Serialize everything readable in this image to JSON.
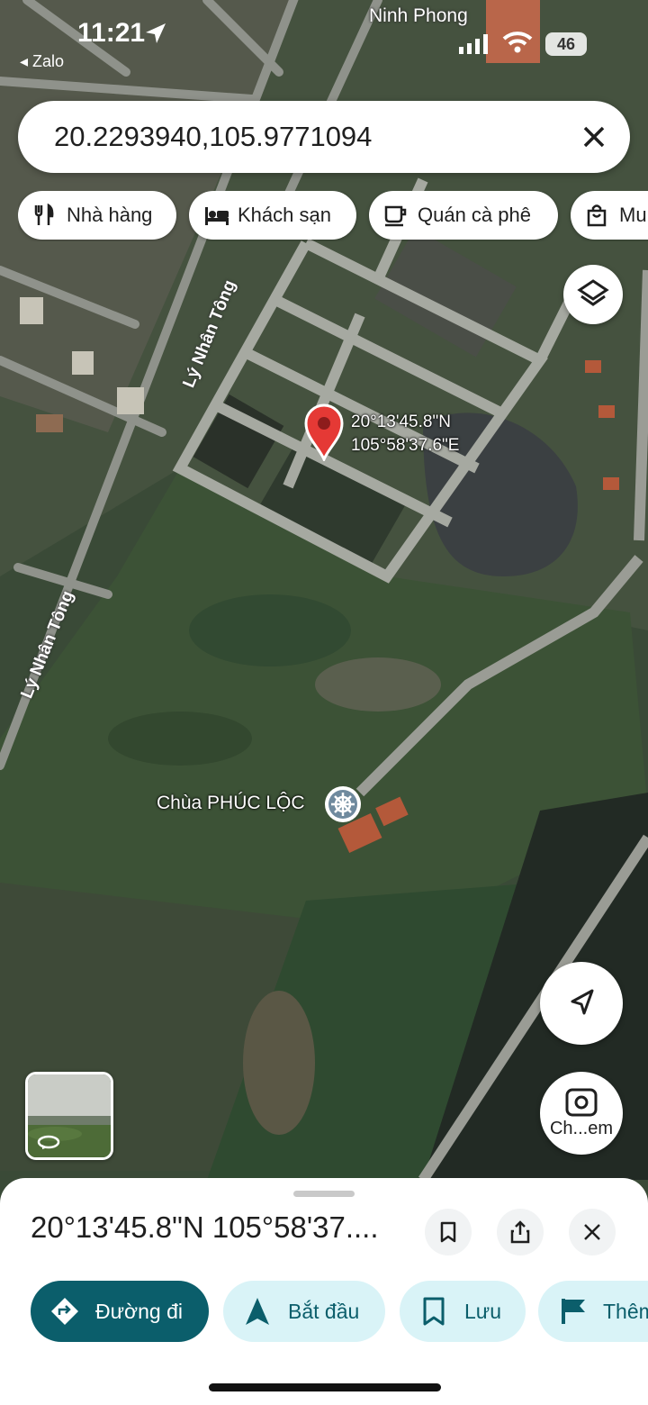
{
  "status_bar": {
    "time": "11:21",
    "back_app": "◂ Zalo",
    "battery": "46"
  },
  "search": {
    "value": "20.2293940,105.9771094"
  },
  "chips": [
    {
      "label": "Nhà hàng",
      "icon": "fork-knife-icon"
    },
    {
      "label": "Khách sạn",
      "icon": "bed-icon"
    },
    {
      "label": "Quán cà phê",
      "icon": "coffee-cup-icon"
    },
    {
      "label": "Mu",
      "icon": "shopping-bag-icon"
    }
  ],
  "map": {
    "pin_lat": "20°13'45.8\"N",
    "pin_lng": "105°58'37.6\"E",
    "place_top": "Ninh Phong",
    "road_1": "Lý Nhân Tông",
    "road_2": "Lý Nhân Tông",
    "poi": "Chùa PHÚC LỘC",
    "lens_label": "Ch...em"
  },
  "sheet": {
    "title": "20°13'45.8\"N 105°58'37....",
    "actions": [
      {
        "label": "Đường đi",
        "icon": "directions-icon",
        "primary": true
      },
      {
        "label": "Bắt đầu",
        "icon": "navigation-arrow-icon",
        "primary": false
      },
      {
        "label": "Lưu",
        "icon": "bookmark-icon",
        "primary": false
      },
      {
        "label": "Thêm",
        "icon": "flag-icon",
        "primary": false
      }
    ]
  },
  "colors": {
    "accent": "#0b5e6b",
    "secondary_bg": "#d9f3f7",
    "pin": "#e53935"
  }
}
